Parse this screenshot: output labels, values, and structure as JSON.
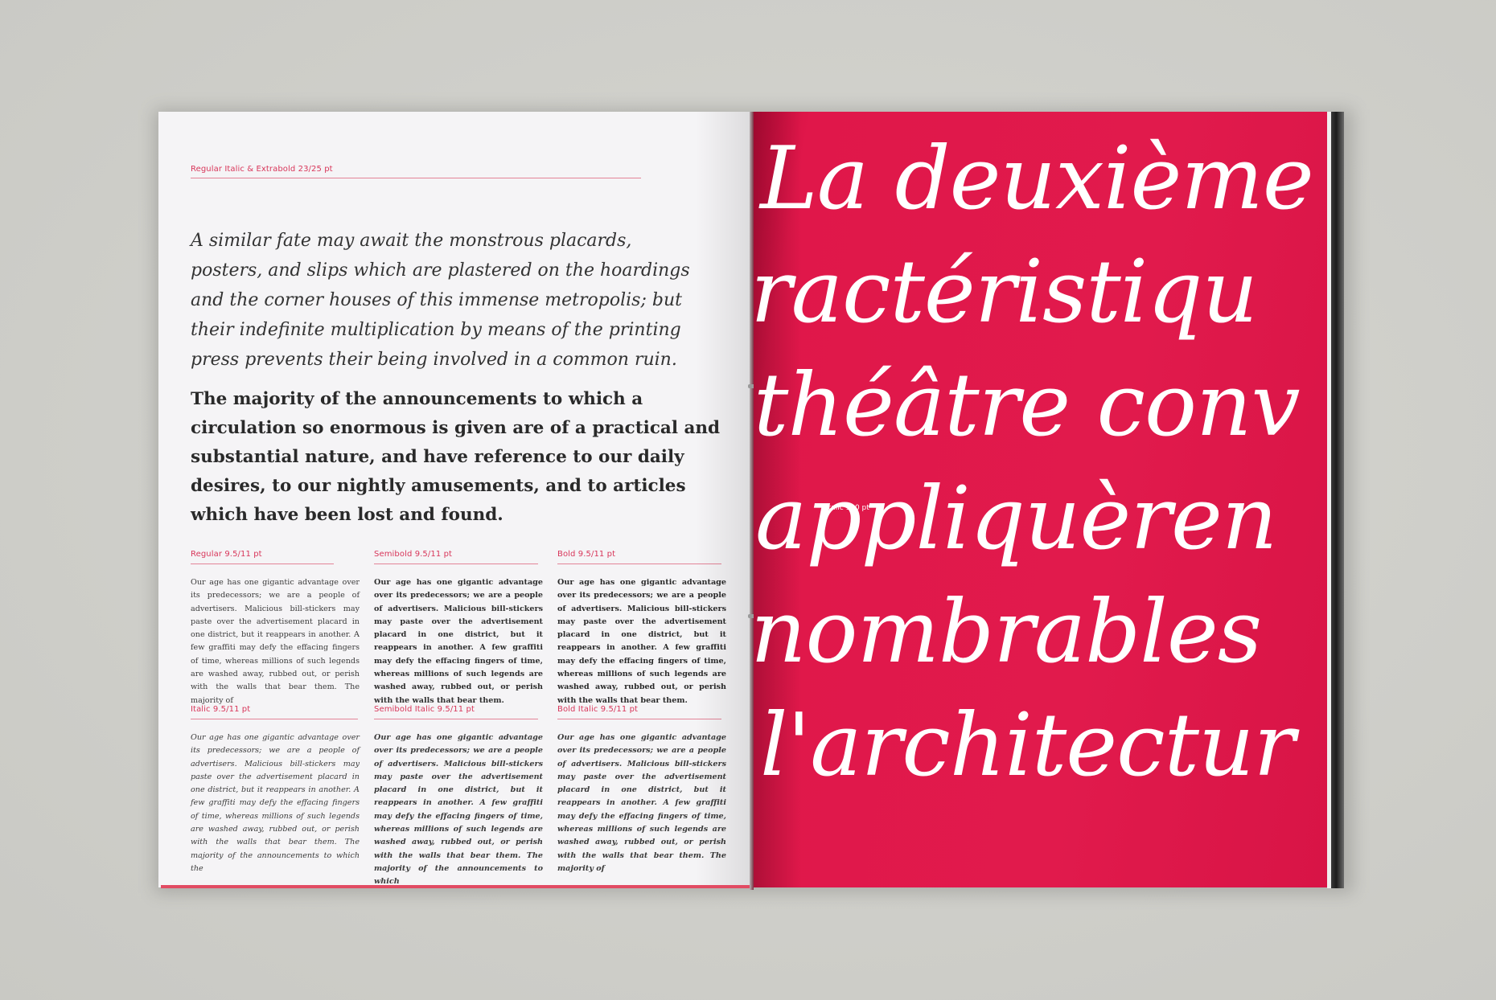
{
  "left_page": {
    "header_label": "Regular Italic & Extrabold 23/25 pt",
    "lead_italic": "A similar fate may await the monstrous placards, posters, and slips which are plastered on the hoardings and the corner houses of this immense metropolis; but their indefinite multiplication by means of the printing press prevents their being involved in a common ruin.",
    "lead_bold": "The majority of the announcements to which a circulation so enormous is given are of a practical and substantial nature, and have reference to our daily desires, to our nightly amusements, and to articles which have been lost and found.",
    "columns_row1": [
      {
        "label": "Regular 9.5/11 pt",
        "text": "Our age has one gigantic advantage over its predecessors; we are a people of advertisers. Malicious bill-stickers may paste over the advertisement placard in one district, but it reappears in another. A few graffiti may defy the effacing fingers of time, whereas millions of such legends are washed away, rubbed out, or perish with the walls that bear them. The majority of"
      },
      {
        "label": "Semibold 9.5/11 pt",
        "text": "Our age has one gigantic advantage over its predecessors; we are a people of advertisers. Malicious bill-stickers may paste over the advertisement placard in one district, but it reappears in another. A few graffiti may defy the effacing fingers of time, whereas millions of such legends are washed away, rubbed out, or perish with the walls that bear them."
      },
      {
        "label": "Bold 9.5/11 pt",
        "text": "Our age has one gigantic advantage over its predecessors; we are a people of advertisers. Malicious bill-stickers may paste over the advertisement placard in one district, but it reappears in another. A few graffiti may defy the effacing fingers of time, whereas millions of such legends are washed away, rubbed out, or perish with the walls that bear them."
      }
    ],
    "columns_row2": [
      {
        "label": "Italic 9.5/11 pt",
        "text": "Our age has one gigantic advantage over its predecessors; we are a people of advertisers. Malicious bill-stickers may paste over the advertisement placard in one district, but it reappears in another. A few graffiti may defy the effacing fingers of time, whereas millions of such legends are washed away, rubbed out, or perish with the walls that bear them. The majority of the announcements to which the"
      },
      {
        "label": "Semibold Italic 9.5/11 pt",
        "text": "Our age has one gigantic advantage over its predecessors; we are a people of advertisers. Malicious bill-stickers may paste over the advertisement placard in one district, but it reappears in another. A few graffiti may defy the effacing fingers of time, whereas millions of such legends are washed away, rubbed out, or perish with the walls that bear them. The majority of the announcements to which"
      },
      {
        "label": "Bold Italic 9.5/11 pt",
        "text": "Our age has one gigantic advantage over its predecessors; we are a people of advertisers. Malicious bill-stickers may paste over the advertisement placard in one district, but it reappears in another. A few graffiti may defy the effacing fingers of time, whereas millions of such legends are washed away, rubbed out, or perish with the walls that bear them. The majority of"
      }
    ]
  },
  "right_page": {
    "size_label": "Italic 130 pt",
    "lines": [
      "La deuxième",
      "ractéristiqu",
      "théâtre conv",
      "appliquèren",
      "nombrables",
      "l'architectur"
    ],
    "background_color": "#e11a4c"
  }
}
